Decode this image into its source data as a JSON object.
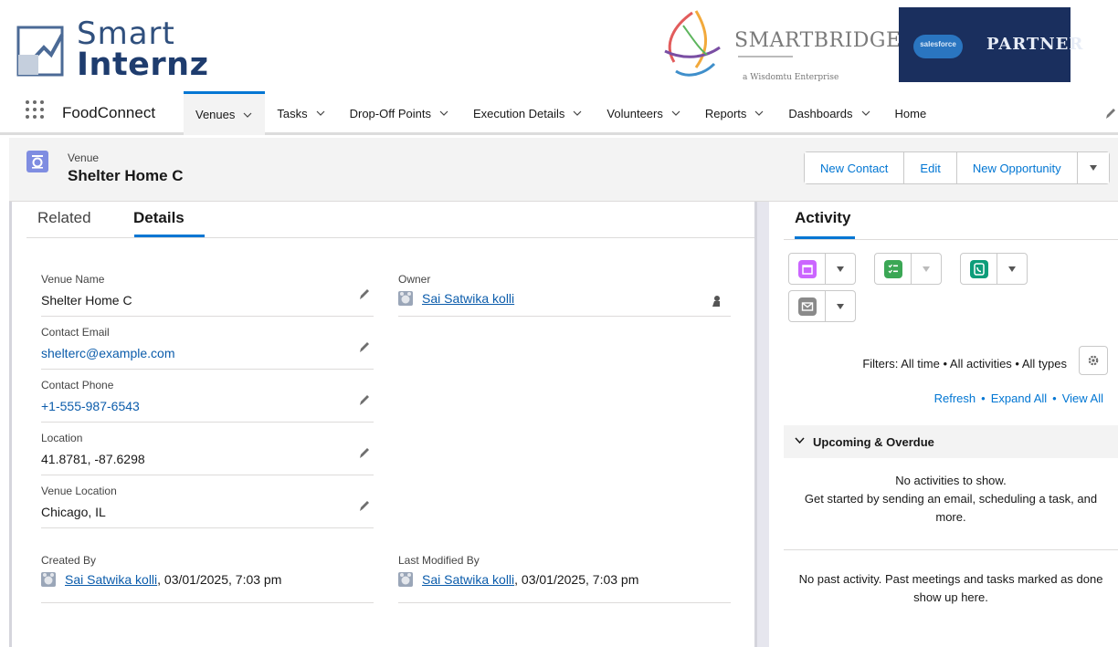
{
  "banner": {
    "logo_left_line1": "Smart",
    "logo_left_line2": "Internz",
    "logo_middle": "SMARTBRIDGE",
    "logo_middle_tagline": "a Wisdomtu Enterprise",
    "logo_right": "PARTNER",
    "logo_right_cloud": "salesforce"
  },
  "nav": {
    "app_name": "FoodConnect",
    "items": [
      {
        "label": "Venues",
        "active": true
      },
      {
        "label": "Tasks"
      },
      {
        "label": "Drop-Off Points"
      },
      {
        "label": "Execution Details"
      },
      {
        "label": "Volunteers"
      },
      {
        "label": "Reports"
      },
      {
        "label": "Dashboards"
      },
      {
        "label": "Home"
      }
    ]
  },
  "record": {
    "type": "Venue",
    "title": "Shelter Home C",
    "buttons": {
      "new_contact": "New Contact",
      "edit": "Edit",
      "new_opportunity": "New Opportunity"
    }
  },
  "tabs": {
    "related": "Related",
    "details": "Details"
  },
  "details": {
    "venue_name": {
      "label": "Venue Name",
      "value": "Shelter Home C"
    },
    "contact_email": {
      "label": "Contact Email",
      "value": "shelterc@example.com"
    },
    "contact_phone": {
      "label": "Contact Phone",
      "value": "+1-555-987-6543"
    },
    "location": {
      "label": "Location",
      "value": "41.8781, -87.6298"
    },
    "venue_location": {
      "label": "Venue Location",
      "value": "Chicago, IL"
    },
    "owner": {
      "label": "Owner",
      "value": "Sai Satwika kolli"
    },
    "created_by": {
      "label": "Created By",
      "user": "Sai Satwika kolli",
      "date": ", 03/01/2025, 7:03 pm"
    },
    "last_modified_by": {
      "label": "Last Modified By",
      "user": "Sai Satwika kolli",
      "date": ", 03/01/2025, 7:03 pm"
    }
  },
  "activity": {
    "title": "Activity",
    "filters": "Filters: All time • All activities • All types",
    "links": {
      "refresh": "Refresh",
      "expand_all": "Expand All",
      "view_all": "View All",
      "sep": "•"
    },
    "upcoming": "Upcoming & Overdue",
    "no_activities": "No activities to show.",
    "get_started": "Get started by sending an email, scheduling a task, and more.",
    "past": "No past activity. Past meetings and tasks marked as done show up here.",
    "colors": {
      "event": "#cb65ff",
      "task": "#3ba755",
      "call": "#0d9d7a",
      "email": "#8a8a8a"
    }
  }
}
